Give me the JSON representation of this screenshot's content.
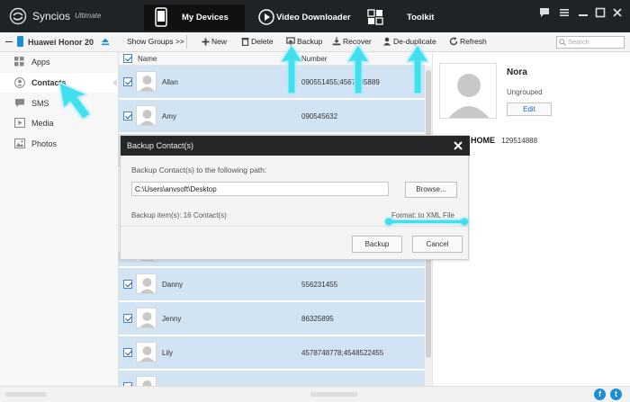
{
  "app": {
    "name": "Syncios",
    "edition": "Ultimate"
  },
  "top_tabs": [
    {
      "label": "My Devices",
      "active": true
    },
    {
      "label": "Video Downloader",
      "active": false
    },
    {
      "label": "Toolkit",
      "active": false
    }
  ],
  "device": {
    "name": "Huawei Honor 20"
  },
  "toolbar": {
    "show_groups": "Show Groups >>",
    "new": "New",
    "delete": "Delete",
    "backup": "Backup",
    "recover": "Recover",
    "deduplicate": "De-duplicate",
    "refresh": "Refresh",
    "search_placeholder": "Search"
  },
  "sidebar": {
    "items": [
      {
        "label": "Apps",
        "icon": "apps-icon",
        "active": false
      },
      {
        "label": "Contacts",
        "icon": "contacts-icon",
        "active": true
      },
      {
        "label": "SMS",
        "icon": "sms-icon",
        "active": false
      },
      {
        "label": "Media",
        "icon": "media-icon",
        "active": false
      },
      {
        "label": "Photos",
        "icon": "photos-icon",
        "active": false
      }
    ]
  },
  "list": {
    "headers": {
      "name": "Name",
      "number": "Number"
    },
    "rows": [
      {
        "name": "Allan",
        "number": "090551455;4567885",
        "number_tail": "889"
      },
      {
        "name": "Amy",
        "number": "090545632"
      },
      {
        "name": "Danny",
        "number": "556231455"
      },
      {
        "name": "Jenny",
        "number": "86325895"
      },
      {
        "name": "Lily",
        "number": "4578748778;4548522455"
      }
    ]
  },
  "detail": {
    "name": "Nora",
    "group": "Ungrouped",
    "edit": "Edit",
    "home_label": "HOME",
    "home_value": "129514888"
  },
  "dialog": {
    "title": "Backup Contact(s)",
    "path_label": "Backup Contact(s) to the following path:",
    "path_value": "C:\\Users\\anvsoft\\Desktop",
    "browse": "Browse...",
    "items": "Backup item(s): 16 Contact(s)",
    "format": "Format: to XML File",
    "backup": "Backup",
    "cancel": "Cancel"
  },
  "colors": {
    "titlebar": "#1f2325",
    "row_selected": "#d2e3f3",
    "accent_blue": "#1a8fd8",
    "annotation": "#3fe0ee"
  }
}
